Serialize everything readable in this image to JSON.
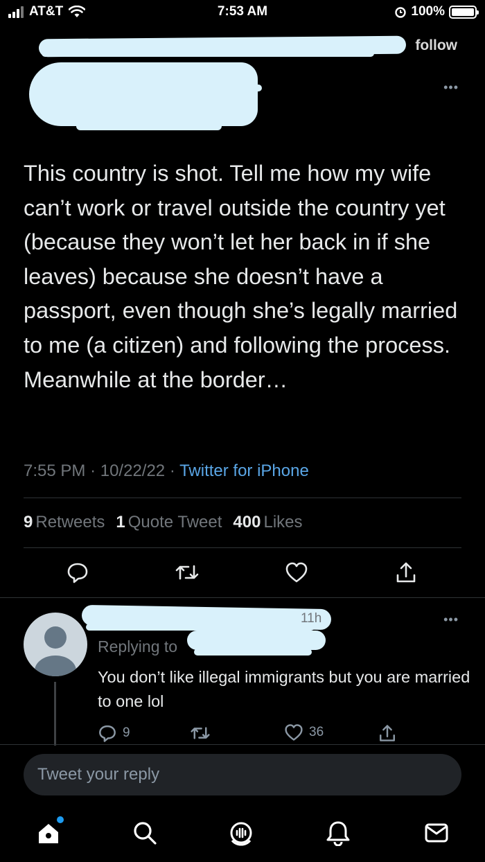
{
  "status_bar": {
    "carrier": "AT&T",
    "time": "7:53 AM",
    "battery": "100%"
  },
  "header": {
    "follow_label": "follow",
    "more_icon": "more-horizontal-icon"
  },
  "tweet": {
    "text": "This country is shot. Tell me how my wife can’t work or travel outside the country yet (because they won’t let her back in if she leaves) because she doesn’t have a passport, even though she’s legally married to me (a citizen) and following the process. Meanwhile at the border…",
    "time": "7:55 PM",
    "date": "10/22/22",
    "source": "Twitter for iPhone",
    "stats": {
      "retweets_count": "9",
      "retweets_label": "Retweets",
      "quotes_count": "1",
      "quotes_label": "Quote Tweet",
      "likes_count": "400",
      "likes_label": "Likes"
    },
    "actions": [
      "reply-icon",
      "retweet-icon",
      "like-icon",
      "share-icon"
    ]
  },
  "reply": {
    "age": "11h",
    "replying_label": "Replying to",
    "text": "You don’t like illegal immigrants but you are married to one lol",
    "reply_count": "9",
    "like_count": "36"
  },
  "compose": {
    "placeholder": "Tweet your reply"
  },
  "tabs": [
    "home-icon",
    "search-icon",
    "spaces-icon",
    "notifications-icon",
    "messages-icon"
  ],
  "colors": {
    "background": "#000000",
    "accent": "#1d9bf0",
    "link": "#5aa6e6",
    "muted": "#71767b",
    "redaction": "#d9f1fb"
  }
}
